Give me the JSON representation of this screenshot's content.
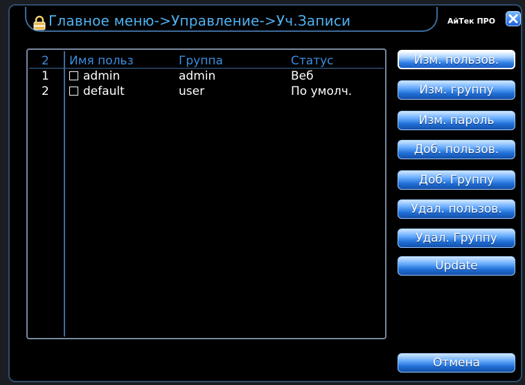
{
  "titlebar": {
    "title": "Главное меню->Управление->Уч.Записи",
    "brand": "AйTек ПРО"
  },
  "user_list": {
    "header": {
      "count": "2",
      "name": "Имя польз",
      "group": "Группа",
      "status": "Статус"
    },
    "rows": [
      {
        "index": "1",
        "name": "admin",
        "group": "admin",
        "status": "Веб"
      },
      {
        "index": "2",
        "name": "default",
        "group": "user",
        "status": "По умолч."
      }
    ]
  },
  "buttons": {
    "edit_user": "Изм. пользов.",
    "edit_group": "Изм. группу",
    "edit_password": "Изм. пароль",
    "add_user": "Доб. пользов.",
    "add_group": "Доб. Группу",
    "delete_user": "Удал. пользов.",
    "delete_group": "Удал. Группу",
    "update": "Update",
    "cancel": "Отмена"
  },
  "icons": {
    "lock": "lock-icon",
    "close": "close-icon"
  },
  "colors": {
    "accent": "#4fb2f0",
    "button": "#1f6fd8",
    "background": "#000000"
  }
}
